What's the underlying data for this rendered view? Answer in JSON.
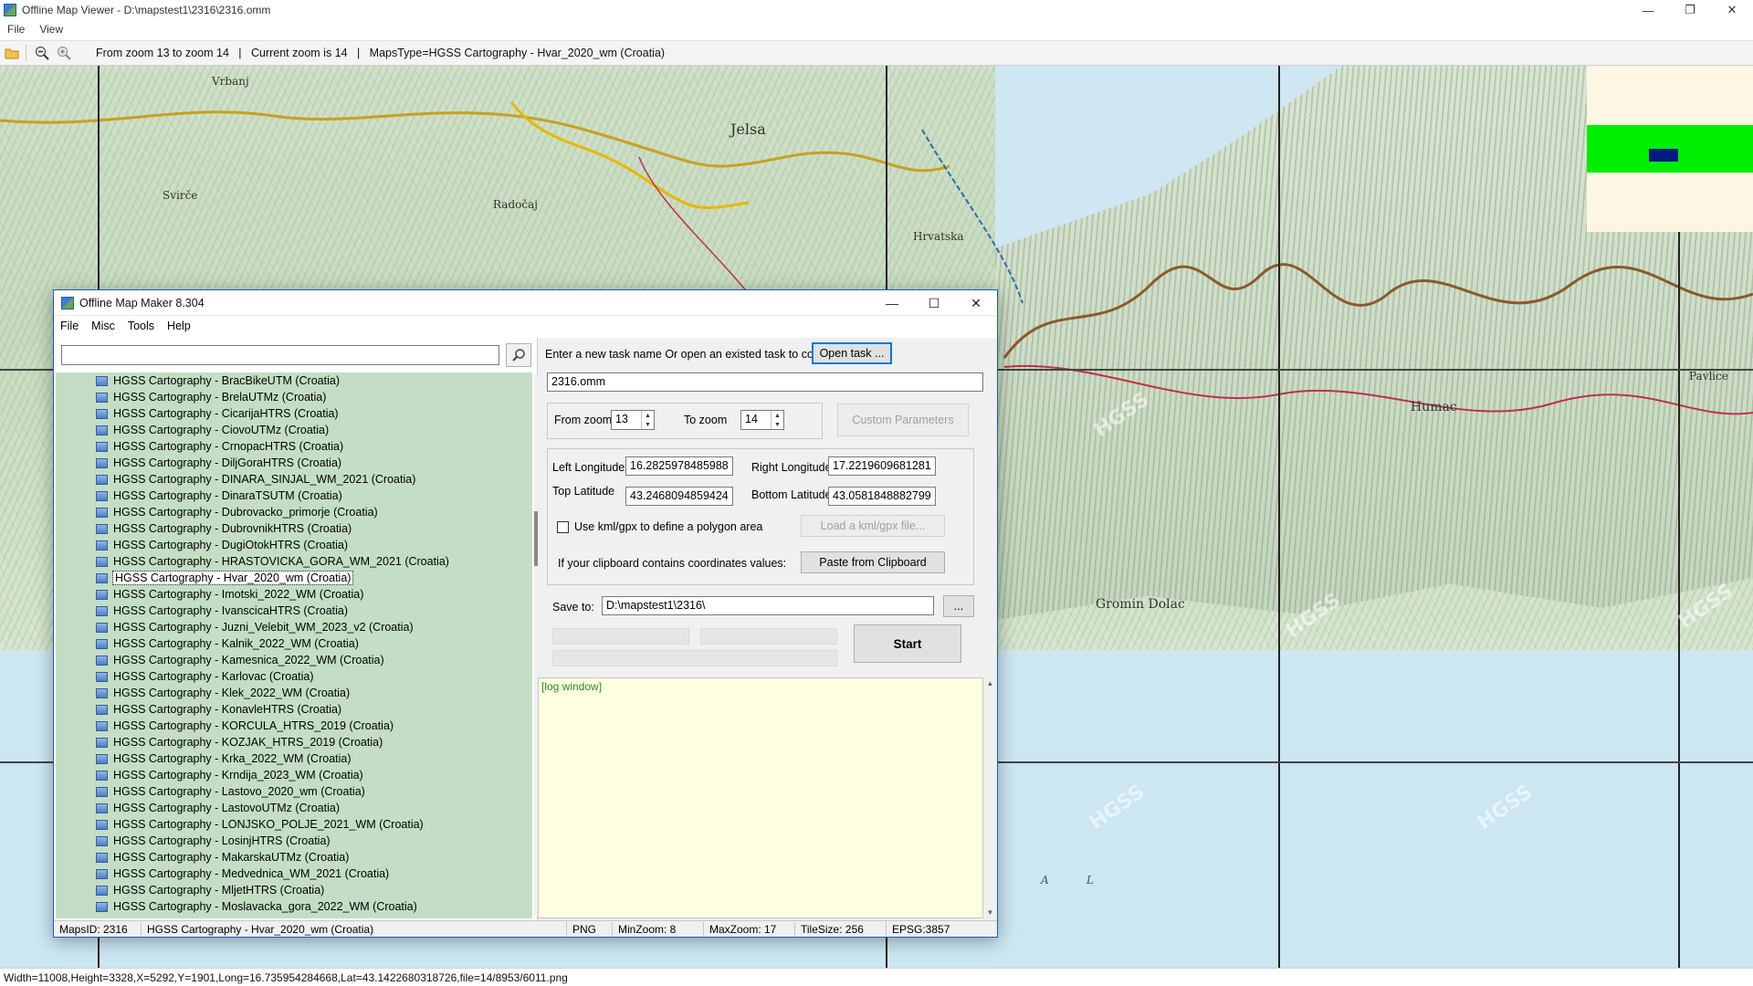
{
  "viewer": {
    "title": "Offline Map Viewer - D:\\mapstest1\\2316\\2316.omm",
    "menu": [
      "File",
      "View"
    ],
    "toolbar_info": "From zoom 13 to zoom 14   |   Current zoom is 14   |   MapsType=HGSS Cartography - Hvar_2020_wm (Croatia)",
    "status": "Width=11008,Height=3328,X=5292,Y=1901,Long=16.735954284668,Lat=43.1422680318726,file=14/8953/6011.png"
  },
  "map": {
    "labels": [
      "Vrbanj",
      "Jelsa",
      "Svirče",
      "Humac",
      "Gromin Dolac",
      "Pavlice",
      "Radočaj",
      "Hrvatska",
      "A",
      "L"
    ],
    "watermark": "HGSS",
    "overview_colors": {
      "background": "#fdf6e3",
      "band": "#00ee00",
      "viewport": "#001a80"
    }
  },
  "dialog": {
    "title": "Offline Map Maker 8.304",
    "menu": [
      "File",
      "Misc",
      "Tools",
      "Help"
    ],
    "search": {
      "value": "",
      "placeholder": ""
    },
    "tree_items": [
      "HGSS Cartography - BracBikeUTM (Croatia)",
      "HGSS Cartography - BrelaUTMz (Croatia)",
      "HGSS Cartography - CicarijaHTRS (Croatia)",
      "HGSS Cartography - CiovoUTMz (Croatia)",
      "HGSS Cartography - CrnopacHTRS (Croatia)",
      "HGSS Cartography - DiljGoraHTRS (Croatia)",
      "HGSS Cartography - DINARA_SINJAL_WM_2021 (Croatia)",
      "HGSS Cartography - DinaraTSUTM (Croatia)",
      "HGSS Cartography - Dubrovacko_primorje (Croatia)",
      "HGSS Cartography - DubrovnikHTRS (Croatia)",
      "HGSS Cartography - DugiOtokHTRS (Croatia)",
      "HGSS Cartography - HRASTOVICKA_GORA_WM_2021 (Croatia)",
      "HGSS Cartography - Hvar_2020_wm (Croatia)",
      "HGSS Cartography - Imotski_2022_WM (Croatia)",
      "HGSS Cartography - IvanscicaHTRS (Croatia)",
      "HGSS Cartography - Juzni_Velebit_WM_2023_v2 (Croatia)",
      "HGSS Cartography - Kalnik_2022_WM (Croatia)",
      "HGSS Cartography - Kamesnica_2022_WM (Croatia)",
      "HGSS Cartography - Karlovac (Croatia)",
      "HGSS Cartography - Klek_2022_WM (Croatia)",
      "HGSS Cartography - KonavleHTRS (Croatia)",
      "HGSS Cartography - KORCULA_HTRS_2019 (Croatia)",
      "HGSS Cartography - KOZJAK_HTRS_2019 (Croatia)",
      "HGSS Cartography - Krka_2022_WM (Croatia)",
      "HGSS Cartography - Krndija_2023_WM (Croatia)",
      "HGSS Cartography - Lastovo_2020_wm (Croatia)",
      "HGSS Cartography - LastovoUTMz (Croatia)",
      "HGSS Cartography - LONJSKO_POLJE_2021_WM (Croatia)",
      "HGSS Cartography - LosinjHTRS (Croatia)",
      "HGSS Cartography - MakarskaUTMz (Croatia)",
      "HGSS Cartography - Medvednica_WM_2021 (Croatia)",
      "HGSS Cartography - MljetHTRS (Croatia)",
      "HGSS Cartography - Moslavacka_gora_2022_WM (Croatia)"
    ],
    "selected_item": "HGSS Cartography - Hvar_2020_wm (Croatia)",
    "task_prompt": "Enter a new task name Or open an existed task to continue:",
    "open_task_label": "Open task ...",
    "task_name": "2316.omm",
    "from_zoom_label": "From zoom",
    "from_zoom_value": "13",
    "to_zoom_label": "To zoom",
    "to_zoom_value": "14",
    "custom_params_label": "Custom Parameters",
    "left_lon_label": "Left Longitude",
    "left_lon_value": "16.2825978485988",
    "right_lon_label": "Right Longitude",
    "right_lon_value": "17.2219609681281",
    "top_lat_label": "Top Latitude",
    "top_lat_value": "43.2468094859424",
    "bottom_lat_label": "Bottom Latitude",
    "bottom_lat_value": "43.0581848882799",
    "kml_checkbox_label": "Use kml/gpx to define a polygon area",
    "load_kml_label": "Load a kml/gpx file...",
    "clipboard_prompt": "If your clipboard contains coordinates values:",
    "paste_label": "Paste from Clipboard",
    "save_to_label": "Save to:",
    "save_to_value": "D:\\mapstest1\\2316\\",
    "browse_label": "...",
    "start_label": "Start",
    "log_text": "[log window]",
    "status": {
      "maps_id": "MapsID: 2316",
      "maps_name": "HGSS Cartography - Hvar_2020_wm (Croatia)",
      "format": "PNG",
      "min_zoom": "MinZoom: 8",
      "max_zoom": "MaxZoom: 17",
      "tile_size": "TileSize: 256",
      "epsg": "EPSG:3857"
    }
  }
}
